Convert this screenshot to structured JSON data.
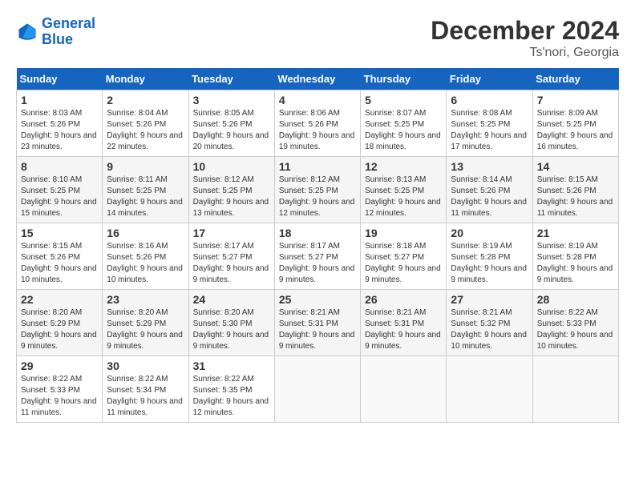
{
  "header": {
    "logo_line1": "General",
    "logo_line2": "Blue",
    "month_title": "December 2024",
    "location": "Ts'nori, Georgia"
  },
  "weekdays": [
    "Sunday",
    "Monday",
    "Tuesday",
    "Wednesday",
    "Thursday",
    "Friday",
    "Saturday"
  ],
  "weeks": [
    [
      {
        "day": "1",
        "sunrise": "8:03 AM",
        "sunset": "5:26 PM",
        "daylight": "9 hours and 23 minutes"
      },
      {
        "day": "2",
        "sunrise": "8:04 AM",
        "sunset": "5:26 PM",
        "daylight": "9 hours and 22 minutes"
      },
      {
        "day": "3",
        "sunrise": "8:05 AM",
        "sunset": "5:26 PM",
        "daylight": "9 hours and 20 minutes"
      },
      {
        "day": "4",
        "sunrise": "8:06 AM",
        "sunset": "5:26 PM",
        "daylight": "9 hours and 19 minutes"
      },
      {
        "day": "5",
        "sunrise": "8:07 AM",
        "sunset": "5:25 PM",
        "daylight": "9 hours and 18 minutes"
      },
      {
        "day": "6",
        "sunrise": "8:08 AM",
        "sunset": "5:25 PM",
        "daylight": "9 hours and 17 minutes"
      },
      {
        "day": "7",
        "sunrise": "8:09 AM",
        "sunset": "5:25 PM",
        "daylight": "9 hours and 16 minutes"
      }
    ],
    [
      {
        "day": "8",
        "sunrise": "8:10 AM",
        "sunset": "5:25 PM",
        "daylight": "9 hours and 15 minutes"
      },
      {
        "day": "9",
        "sunrise": "8:11 AM",
        "sunset": "5:25 PM",
        "daylight": "9 hours and 14 minutes"
      },
      {
        "day": "10",
        "sunrise": "8:12 AM",
        "sunset": "5:25 PM",
        "daylight": "9 hours and 13 minutes"
      },
      {
        "day": "11",
        "sunrise": "8:12 AM",
        "sunset": "5:25 PM",
        "daylight": "9 hours and 12 minutes"
      },
      {
        "day": "12",
        "sunrise": "8:13 AM",
        "sunset": "5:25 PM",
        "daylight": "9 hours and 12 minutes"
      },
      {
        "day": "13",
        "sunrise": "8:14 AM",
        "sunset": "5:26 PM",
        "daylight": "9 hours and 11 minutes"
      },
      {
        "day": "14",
        "sunrise": "8:15 AM",
        "sunset": "5:26 PM",
        "daylight": "9 hours and 11 minutes"
      }
    ],
    [
      {
        "day": "15",
        "sunrise": "8:15 AM",
        "sunset": "5:26 PM",
        "daylight": "9 hours and 10 minutes"
      },
      {
        "day": "16",
        "sunrise": "8:16 AM",
        "sunset": "5:26 PM",
        "daylight": "9 hours and 10 minutes"
      },
      {
        "day": "17",
        "sunrise": "8:17 AM",
        "sunset": "5:27 PM",
        "daylight": "9 hours and 9 minutes"
      },
      {
        "day": "18",
        "sunrise": "8:17 AM",
        "sunset": "5:27 PM",
        "daylight": "9 hours and 9 minutes"
      },
      {
        "day": "19",
        "sunrise": "8:18 AM",
        "sunset": "5:27 PM",
        "daylight": "9 hours and 9 minutes"
      },
      {
        "day": "20",
        "sunrise": "8:19 AM",
        "sunset": "5:28 PM",
        "daylight": "9 hours and 9 minutes"
      },
      {
        "day": "21",
        "sunrise": "8:19 AM",
        "sunset": "5:28 PM",
        "daylight": "9 hours and 9 minutes"
      }
    ],
    [
      {
        "day": "22",
        "sunrise": "8:20 AM",
        "sunset": "5:29 PM",
        "daylight": "9 hours and 9 minutes"
      },
      {
        "day": "23",
        "sunrise": "8:20 AM",
        "sunset": "5:29 PM",
        "daylight": "9 hours and 9 minutes"
      },
      {
        "day": "24",
        "sunrise": "8:20 AM",
        "sunset": "5:30 PM",
        "daylight": "9 hours and 9 minutes"
      },
      {
        "day": "25",
        "sunrise": "8:21 AM",
        "sunset": "5:31 PM",
        "daylight": "9 hours and 9 minutes"
      },
      {
        "day": "26",
        "sunrise": "8:21 AM",
        "sunset": "5:31 PM",
        "daylight": "9 hours and 9 minutes"
      },
      {
        "day": "27",
        "sunrise": "8:21 AM",
        "sunset": "5:32 PM",
        "daylight": "9 hours and 10 minutes"
      },
      {
        "day": "28",
        "sunrise": "8:22 AM",
        "sunset": "5:33 PM",
        "daylight": "9 hours and 10 minutes"
      }
    ],
    [
      {
        "day": "29",
        "sunrise": "8:22 AM",
        "sunset": "5:33 PM",
        "daylight": "9 hours and 11 minutes"
      },
      {
        "day": "30",
        "sunrise": "8:22 AM",
        "sunset": "5:34 PM",
        "daylight": "9 hours and 11 minutes"
      },
      {
        "day": "31",
        "sunrise": "8:22 AM",
        "sunset": "5:35 PM",
        "daylight": "9 hours and 12 minutes"
      },
      null,
      null,
      null,
      null
    ]
  ]
}
